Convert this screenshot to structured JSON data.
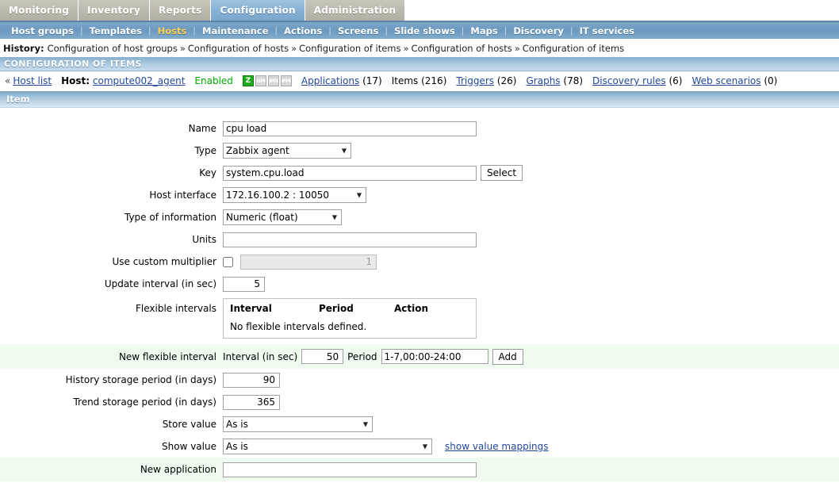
{
  "topmenu": {
    "items": [
      {
        "label": "Monitoring",
        "active": false
      },
      {
        "label": "Inventory",
        "active": false
      },
      {
        "label": "Reports",
        "active": false
      },
      {
        "label": "Configuration",
        "active": true
      },
      {
        "label": "Administration",
        "active": false
      }
    ]
  },
  "submenu": {
    "items": [
      {
        "label": "Host groups",
        "selected": false
      },
      {
        "label": "Templates",
        "selected": false
      },
      {
        "label": "Hosts",
        "selected": true
      },
      {
        "label": "Maintenance",
        "selected": false
      },
      {
        "label": "Actions",
        "selected": false
      },
      {
        "label": "Screens",
        "selected": false
      },
      {
        "label": "Slide shows",
        "selected": false
      },
      {
        "label": "Maps",
        "selected": false
      },
      {
        "label": "Discovery",
        "selected": false
      },
      {
        "label": "IT services",
        "selected": false
      }
    ]
  },
  "history": {
    "label": "History:",
    "separator": "»",
    "crumbs": [
      "Configuration of host groups",
      "Configuration of hosts",
      "Configuration of items",
      "Configuration of hosts",
      "Configuration of items"
    ]
  },
  "page_header": {
    "title": "CONFIGURATION OF ITEMS"
  },
  "host_strip": {
    "back_chevron": "«",
    "host_list_link": "Host list",
    "host_label": "Host:",
    "host_name": "compute002_agent",
    "status": "Enabled",
    "interface_icons": [
      {
        "name": "zabbix-agent-icon",
        "text": "Z",
        "state": "on"
      },
      {
        "name": "snmp-icon",
        "text": "SNMP",
        "state": "off"
      },
      {
        "name": "jmx-icon",
        "text": "JMX",
        "state": "off"
      },
      {
        "name": "ipmi-icon",
        "text": "IPMI",
        "state": "off"
      }
    ],
    "links": [
      {
        "label": "Applications",
        "count": "(17)",
        "current": false
      },
      {
        "label": "Items",
        "count": "(216)",
        "current": true
      },
      {
        "label": "Triggers",
        "count": "(26)",
        "current": false
      },
      {
        "label": "Graphs",
        "count": "(78)",
        "current": false
      },
      {
        "label": "Discovery rules",
        "count": "(6)",
        "current": false
      },
      {
        "label": "Web scenarios",
        "count": "(0)",
        "current": false
      }
    ]
  },
  "form": {
    "panel_title": "Item",
    "name": {
      "label": "Name",
      "value": "cpu load"
    },
    "type": {
      "label": "Type",
      "value": "Zabbix agent"
    },
    "key": {
      "label": "Key",
      "value": "system.cpu.load",
      "select_button": "Select"
    },
    "host_interface": {
      "label": "Host interface",
      "value": "172.16.100.2 : 10050"
    },
    "type_of_information": {
      "label": "Type of information",
      "value": "Numeric (float)"
    },
    "units": {
      "label": "Units",
      "value": ""
    },
    "custom_multiplier": {
      "label": "Use custom multiplier",
      "checked": false,
      "value": "1"
    },
    "update_interval": {
      "label": "Update interval (in sec)",
      "value": "5"
    },
    "flexible_intervals": {
      "label": "Flexible intervals",
      "columns": [
        "Interval",
        "Period",
        "Action"
      ],
      "empty_text": "No flexible intervals defined."
    },
    "new_flexible_interval": {
      "label": "New flexible interval",
      "interval_label": "Interval (in sec)",
      "interval_value": "50",
      "period_label": "Period",
      "period_value": "1-7,00:00-24:00",
      "add_button": "Add"
    },
    "history_storage": {
      "label": "History storage period (in days)",
      "value": "90"
    },
    "trend_storage": {
      "label": "Trend storage period (in days)",
      "value": "365"
    },
    "store_value": {
      "label": "Store value",
      "value": "As is"
    },
    "show_value": {
      "label": "Show value",
      "value": "As is",
      "mappings_link": "show value mappings"
    },
    "new_application": {
      "label": "New application",
      "value": ""
    }
  }
}
